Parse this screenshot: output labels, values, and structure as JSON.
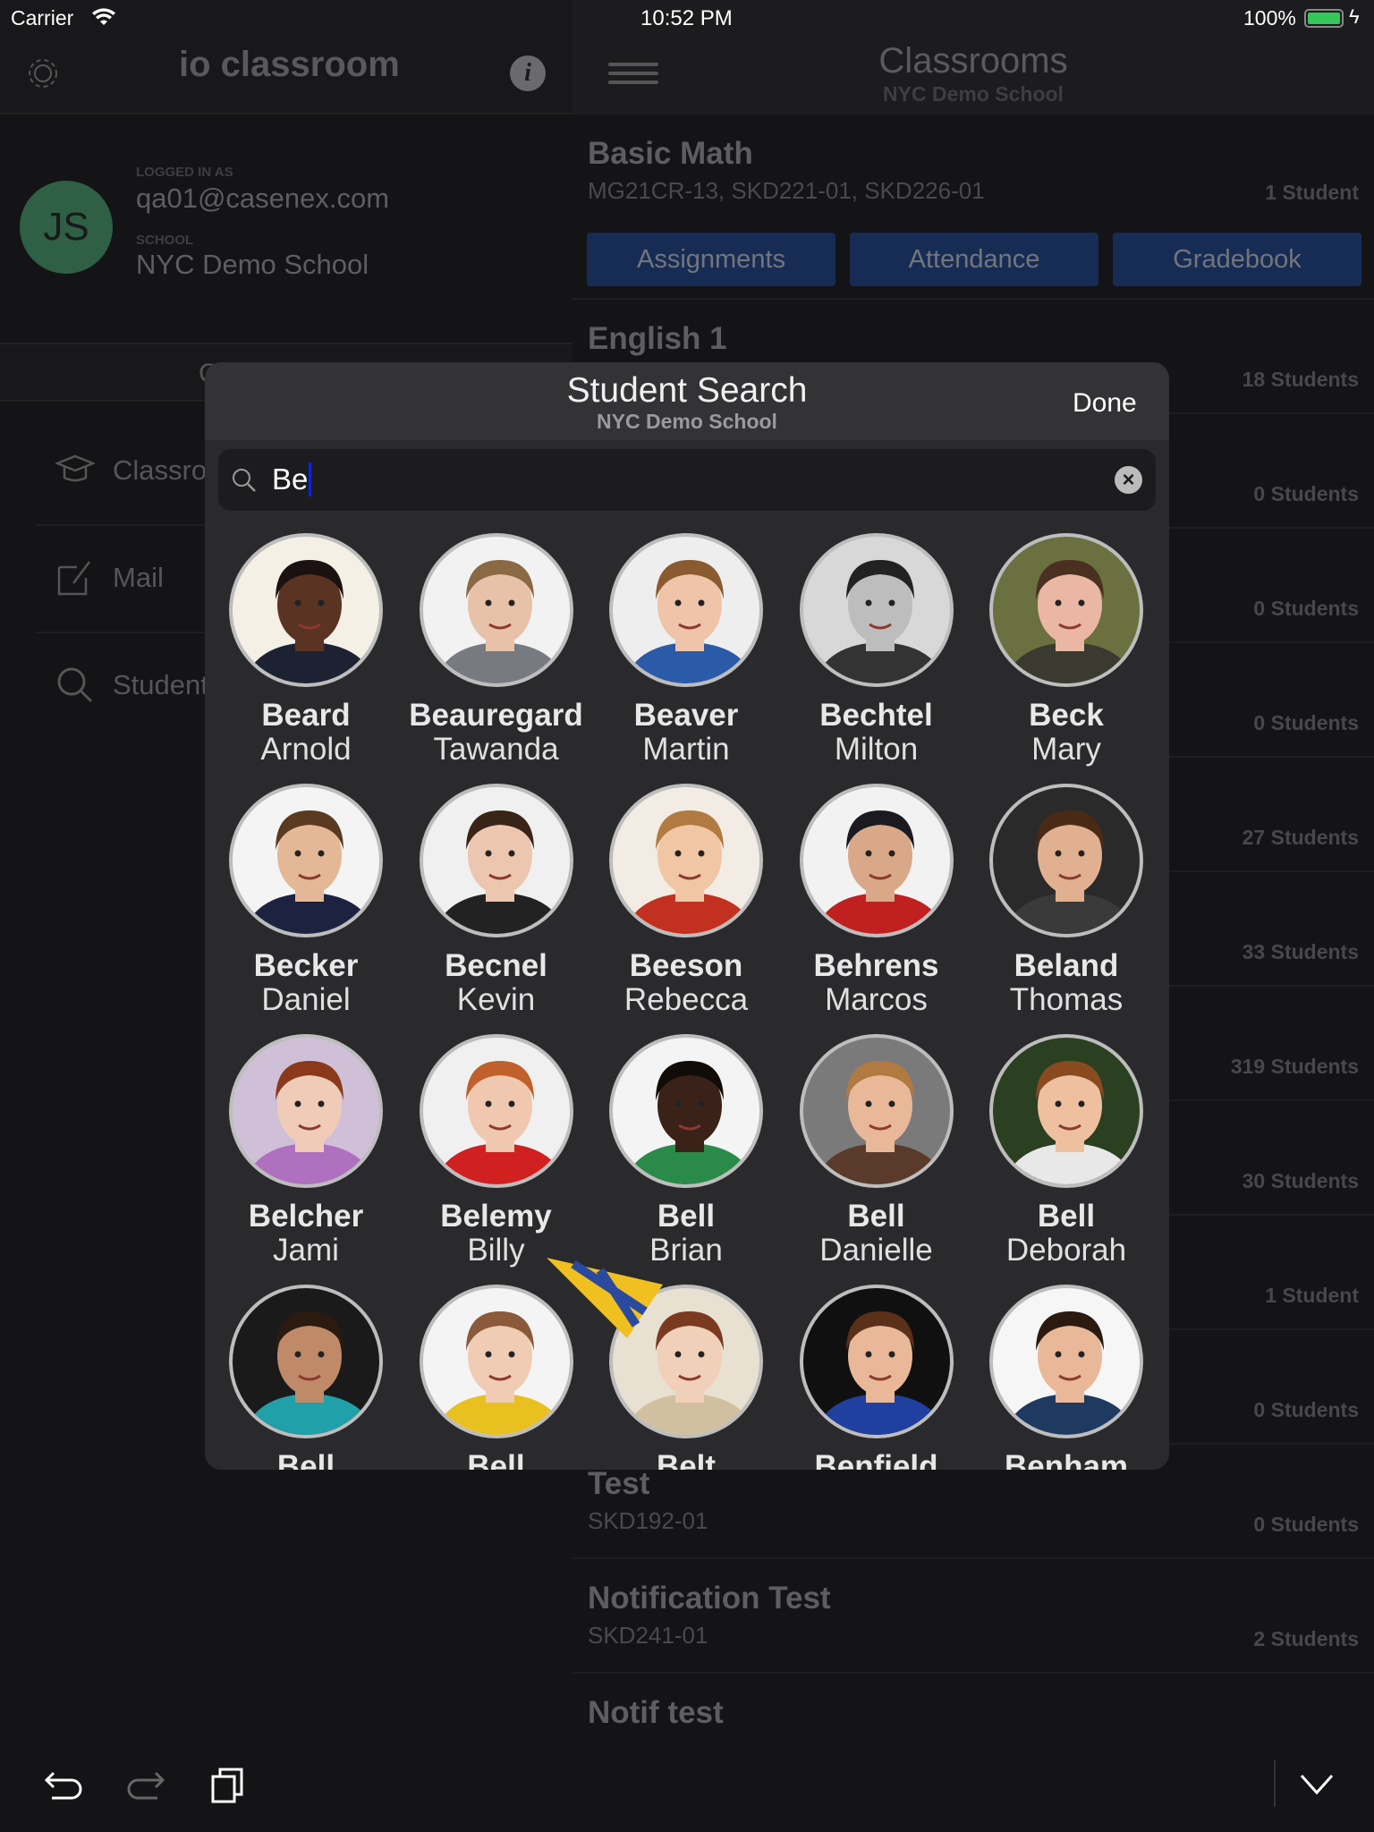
{
  "status_bar": {
    "carrier": "Carrier",
    "time": "10:52 PM",
    "battery": "100%",
    "battery_color": "#34c759"
  },
  "sidebar": {
    "logo": "io classroom",
    "logged_in_label": "LOGGED IN AS",
    "email": "qa01@casenex.com",
    "school_label": "SCHOOL",
    "school": "NYC Demo School",
    "avatar_initials": "JS",
    "avatar_color": "#2f5f45",
    "tab_partial": "C",
    "items": [
      {
        "label": "Classrooms",
        "icon": "graduation-cap-icon"
      },
      {
        "label": "Mail",
        "icon": "compose-icon"
      },
      {
        "label": "Students",
        "icon": "search-icon"
      }
    ]
  },
  "main": {
    "title": "Classrooms",
    "subtitle": "NYC Demo School",
    "buttons": [
      "Assignments",
      "Attendance",
      "Gradebook"
    ],
    "button_color": "#172c55",
    "rows": [
      {
        "title": "Basic Math",
        "codes": "MG21CR-13, SKD221-01, SKD226-01",
        "count": "1 Student"
      },
      {
        "title": "English 1",
        "codes": "",
        "count": "18 Students"
      },
      {
        "title": "",
        "codes": "",
        "count": "0 Students"
      },
      {
        "title": "",
        "codes": "",
        "count": "0 Students"
      },
      {
        "title": "",
        "codes": "",
        "count": "0 Students"
      },
      {
        "title": "",
        "codes": "",
        "count": "27 Students"
      },
      {
        "title": "",
        "codes": "",
        "count": "33 Students"
      },
      {
        "title": "",
        "codes": "",
        "count": "319 Students"
      },
      {
        "title": "",
        "codes": "",
        "count": "30 Students"
      },
      {
        "title": "",
        "codes": "",
        "count": "1 Student"
      },
      {
        "title": "",
        "codes": "",
        "count": "0 Students"
      },
      {
        "title": "Test",
        "codes": "SKD192-01",
        "count": "0 Students"
      },
      {
        "title": "Notification Test",
        "codes": "SKD241-01",
        "count": "2 Students"
      },
      {
        "title": "Notif test",
        "codes": "",
        "count": ""
      }
    ]
  },
  "modal": {
    "title": "Student Search",
    "subtitle": "NYC Demo School",
    "done": "Done",
    "search_value": "Be",
    "students": [
      {
        "last": "Beard",
        "first": "Arnold",
        "bg": "#f4f0e6",
        "skin": "#5a3322",
        "hair": "#1a1210",
        "shirt": "#1d2233"
      },
      {
        "last": "Beauregard",
        "first": "Tawanda",
        "bg": "#f2f2f2",
        "skin": "#e8c2a8",
        "hair": "#8a6a45",
        "shirt": "#777a80"
      },
      {
        "last": "Beaver",
        "first": "Martin",
        "bg": "#eeeeee",
        "skin": "#efc4a8",
        "hair": "#8a5a30",
        "shirt": "#2b5aa8"
      },
      {
        "last": "Bechtel",
        "first": "Milton",
        "bg": "#d8d8d8",
        "skin": "#bdbdbd",
        "hair": "#222222",
        "shirt": "#333333"
      },
      {
        "last": "Beck",
        "first": "Mary",
        "bg": "#6a7040",
        "skin": "#e9b7a3",
        "hair": "#4a3020",
        "shirt": "#3a3a30"
      },
      {
        "last": "Becker",
        "first": "Daniel",
        "bg": "#f4f4f4",
        "skin": "#e4b896",
        "hair": "#5a3a20",
        "shirt": "#1c2240"
      },
      {
        "last": "Becnel",
        "first": "Kevin",
        "bg": "#f0f0f0",
        "skin": "#edc6b0",
        "hair": "#3a2418",
        "shirt": "#222222"
      },
      {
        "last": "Beeson",
        "first": "Rebecca",
        "bg": "#f3ece4",
        "skin": "#f0c6a4",
        "hair": "#b07a40",
        "shirt": "#c23020"
      },
      {
        "last": "Behrens",
        "first": "Marcos",
        "bg": "#f2f2f2",
        "skin": "#d9a888",
        "hair": "#1a1a20",
        "shirt": "#c02020"
      },
      {
        "last": "Beland",
        "first": "Thomas",
        "bg": "#2a2a2a",
        "skin": "#e0b090",
        "hair": "#4a2a14",
        "shirt": "#3a3a3a"
      },
      {
        "last": "Belcher",
        "first": "Jami",
        "bg": "#cfc0d8",
        "skin": "#f0ccb8",
        "hair": "#8a3a1a",
        "shirt": "#b070c0"
      },
      {
        "last": "Belemy",
        "first": "Billy",
        "bg": "#f0f0f0",
        "skin": "#f0c8b0",
        "hair": "#c0602a",
        "shirt": "#d02020"
      },
      {
        "last": "Bell",
        "first": "Brian",
        "bg": "#f4f4f4",
        "skin": "#3a2218",
        "hair": "#120c08",
        "shirt": "#2a8a4a"
      },
      {
        "last": "Bell",
        "first": "Danielle",
        "bg": "#7a7a7a",
        "skin": "#e8b898",
        "hair": "#b07a40",
        "shirt": "#5a3a2a"
      },
      {
        "last": "Bell",
        "first": "Deborah",
        "bg": "#2a4020",
        "skin": "#eec0a0",
        "hair": "#8a4a20",
        "shirt": "#e8e8e8"
      },
      {
        "last": "Bell",
        "first": "",
        "bg": "#1a1a1a",
        "skin": "#c08a68",
        "hair": "#2a1a10",
        "shirt": "#20a0a8"
      },
      {
        "last": "Bell",
        "first": "",
        "bg": "#f4f4f4",
        "skin": "#f0ccb4",
        "hair": "#8a5a3a",
        "shirt": "#e8c020"
      },
      {
        "last": "Belt",
        "first": "",
        "bg": "#e8e0d0",
        "skin": "#f0d0b8",
        "hair": "#7a3a20",
        "shirt": "#d0c0a0"
      },
      {
        "last": "Benfield",
        "first": "",
        "bg": "#101010",
        "skin": "#e8b898",
        "hair": "#5a3018",
        "shirt": "#2040a0"
      },
      {
        "last": "Benham",
        "first": "",
        "bg": "#f6f6f6",
        "skin": "#e8b898",
        "hair": "#2a1a10",
        "shirt": "#1e3a60"
      }
    ]
  },
  "toolbar": {
    "icons": [
      "undo-icon",
      "redo-icon",
      "copy-icon",
      "chevron-down-icon"
    ]
  }
}
